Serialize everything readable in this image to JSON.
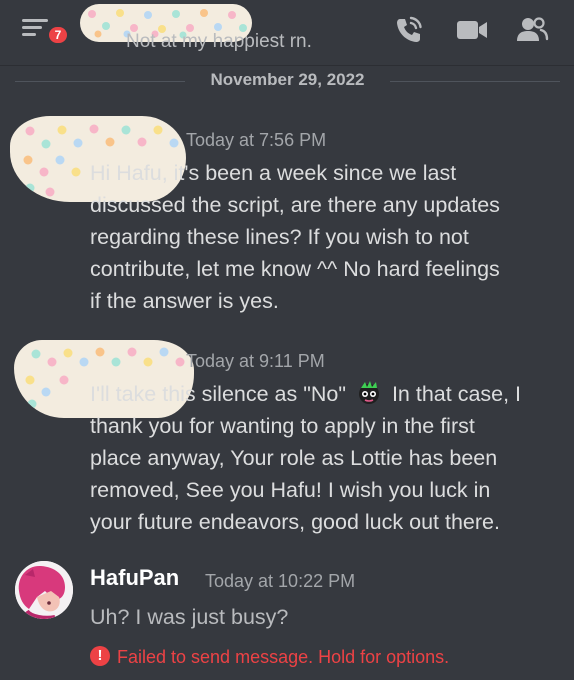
{
  "header": {
    "menu_badge": "7",
    "status_text": "Not at my happiest rn.",
    "icons": [
      "hamburger-menu-icon",
      "phone-call-icon",
      "video-call-icon",
      "members-icon"
    ]
  },
  "divider": {
    "date": "November 29, 2022"
  },
  "messages": [
    {
      "time": "Today at 7:56 PM",
      "lines": [
        "Hi Hafu, it's been a week since we last",
        "discussed the script, are there any updates",
        "regarding these lines? If you wish to not",
        "contribute, let me know ^^ No hard feelings",
        "if the answer is yes."
      ]
    },
    {
      "time": "Today at 9:11 PM",
      "line1_before": "I'll take this silence as \"No\"",
      "line1_after": "In that case, I",
      "lines": [
        "thank you for wanting to apply in the first",
        "place anyway, Your role as Lottie has been",
        "removed,  See you Hafu! I wish you luck in",
        "your future endeavors, good luck out there."
      ]
    },
    {
      "username": "HafuPan",
      "time": "Today at 10:22 PM",
      "text": "Uh? I was just busy?",
      "error": "Failed to send message. Hold for options."
    }
  ],
  "colors": {
    "background": "#36393f",
    "text": "#dcddde",
    "muted": "#a3a6aa",
    "error": "#ed4245"
  }
}
